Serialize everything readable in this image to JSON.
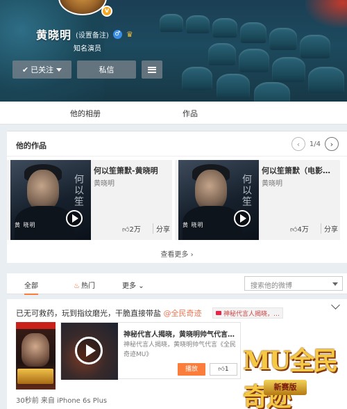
{
  "profile": {
    "name": "黄晓明",
    "remark_link": "(设置备注)",
    "title": "知名演员",
    "verified_badge": "v",
    "gender_icon": "male-icon",
    "member_icon": "crown-icon"
  },
  "actions": {
    "follow_label": "已关注",
    "message_label": "私信",
    "more_icon": "menu-icon"
  },
  "tabs": [
    {
      "label": "他的相册"
    },
    {
      "label": "作品"
    }
  ],
  "works": {
    "title": "他的作品",
    "page": "1/4",
    "items": [
      {
        "title": "何以笙箫默-黄晓明",
        "author": "黄晓明",
        "cover_caption": "黄 晓明",
        "cover_text": "何以笙",
        "likes": "2万",
        "share_label": "分享"
      },
      {
        "title": "何以笙箫默（电影…",
        "author": "黄晓明",
        "cover_caption": "黄 晓明",
        "cover_text": "何以笙",
        "likes": "4万",
        "share_label": "分享"
      }
    ],
    "view_more": "查看更多 ›"
  },
  "feed_filter": {
    "tabs": [
      {
        "label": "全部"
      },
      {
        "label": "热门"
      },
      {
        "label": "更多"
      }
    ],
    "search_placeholder": "搜索他的微博"
  },
  "post": {
    "text_before": "已无可救药，玩到指纹磨光，干脆直接带盐 ",
    "mention": "@全民奇迹",
    "tag": "神秘代言人揭晓，…",
    "card": {
      "title": "神秘代言人揭晓，黄晓明帅气代言…",
      "desc": "神秘代言人揭晓，黄晓明帅气代言《全民奇迹MU》",
      "play_label": "播放",
      "likes": "1"
    },
    "promo_title": "MU全民奇迹",
    "promo_badge": "新赛版",
    "source": "30秒前 来自 iPhone 6s Plus"
  },
  "colors": {
    "accent": "#fa7d3c",
    "link": "#eb7350",
    "page_bg": "#e9eef2"
  }
}
